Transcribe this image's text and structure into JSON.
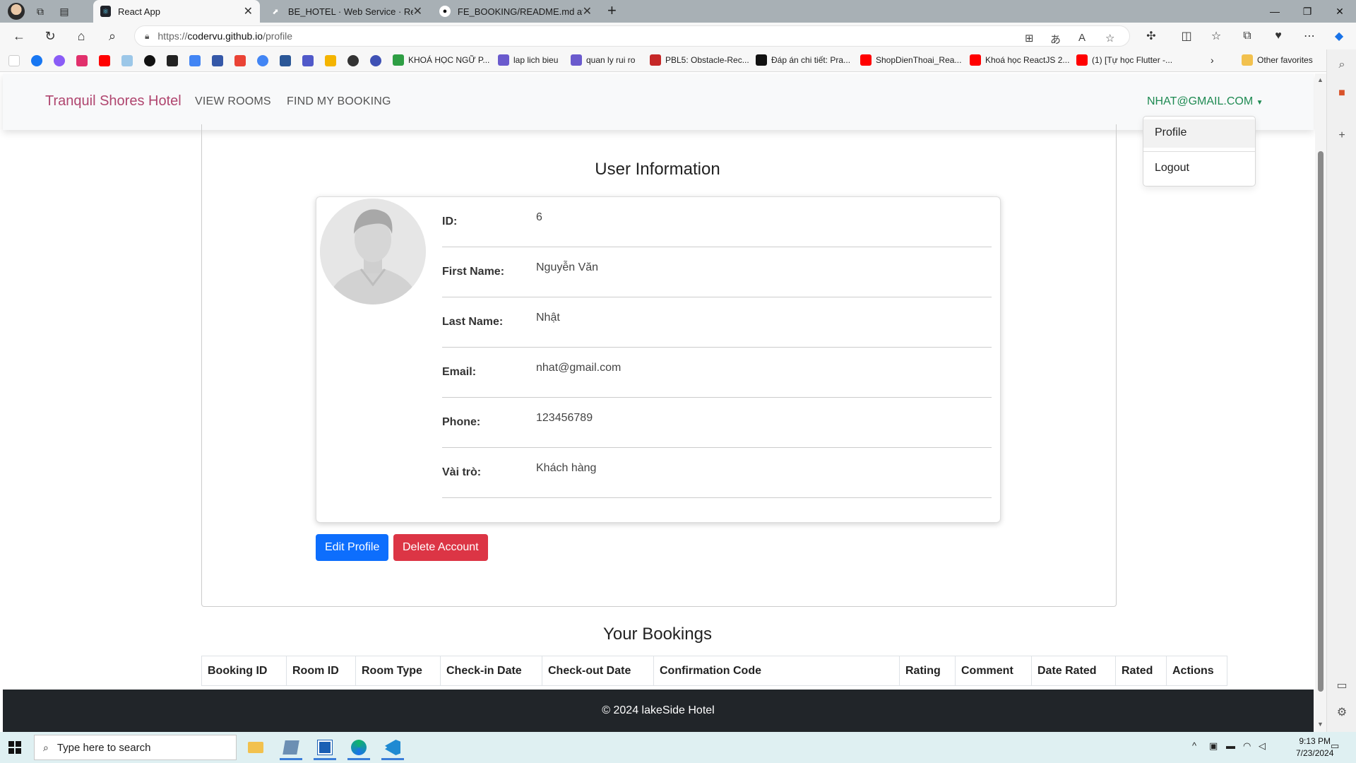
{
  "browser": {
    "tabs": [
      {
        "title": "React App",
        "active": true
      },
      {
        "title": "BE_HOTEL · Web Service · Render",
        "active": false
      },
      {
        "title": "FE_BOOKING/README.md at dev",
        "active": false
      }
    ],
    "url_prefix": "https://",
    "url_host": "codervu.github.io",
    "url_path": "/profile",
    "bookmarks": [
      "KHOÁ HỌC NGỮ P...",
      "lap lich bieu",
      "quan ly rui ro",
      "PBL5: Obstacle-Rec...",
      "Đáp án chi tiết: Pra...",
      "ShopDienThoai_Rea...",
      "Khoá học ReactJS 2...",
      "(1) [Tự học Flutter -..."
    ],
    "other_favorites": "Other favorites"
  },
  "navbar": {
    "brand": "Tranquil Shores Hotel",
    "links": [
      "VIEW ROOMS",
      "FIND MY BOOKING"
    ],
    "user": "NHAT@GMAIL.COM",
    "dropdown": [
      "Profile",
      "Logout"
    ]
  },
  "profile": {
    "title": "User Information",
    "fields": [
      {
        "label": "ID:",
        "value": "6"
      },
      {
        "label": "First Name:",
        "value": "Nguyễn Văn"
      },
      {
        "label": "Last Name:",
        "value": "Nhật"
      },
      {
        "label": "Email:",
        "value": "nhat@gmail.com"
      },
      {
        "label": "Phone:",
        "value": "123456789"
      },
      {
        "label": "Vài trò:",
        "value": "Khách hàng"
      }
    ],
    "edit_label": "Edit Profile",
    "delete_label": "Delete Account"
  },
  "bookings": {
    "title": "Your Bookings",
    "columns": [
      "Booking ID",
      "Room ID",
      "Room Type",
      "Check-in Date",
      "Check-out Date",
      "Confirmation Code",
      "Rating",
      "Comment",
      "Date Rated",
      "Rated",
      "Actions"
    ]
  },
  "footer": {
    "text": "© 2024 lakeSide Hotel"
  },
  "taskbar": {
    "search_placeholder": "Type here to search",
    "time": "9:13 PM",
    "date": "7/23/2024"
  },
  "colors": {
    "brand": "#b0466f",
    "user_link": "#1e8a52",
    "primary": "#0d6efd",
    "danger": "#dc3545",
    "footer_bg": "#212529"
  }
}
